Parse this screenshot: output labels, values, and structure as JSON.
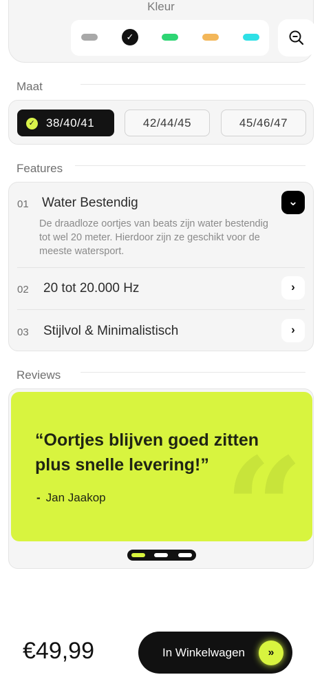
{
  "color": {
    "title": "Kleur",
    "swatches": [
      {
        "name": "grey",
        "hex": "#a8a8a8"
      },
      {
        "name": "black",
        "hex": "#111111",
        "selected": true
      },
      {
        "name": "green",
        "hex": "#2ed573"
      },
      {
        "name": "orange",
        "hex": "#f3b75a"
      },
      {
        "name": "cyan",
        "hex": "#2ee0e6"
      }
    ],
    "selected_check": "✓",
    "zoom_icon": "zoom-out-icon"
  },
  "size": {
    "heading": "Maat",
    "options": [
      "38/40/41",
      "42/44/45",
      "45/46/47"
    ],
    "selected_index": 0,
    "check": "✓"
  },
  "features": {
    "heading": "Features",
    "items": [
      {
        "num": "01",
        "title": "Water Bestendig",
        "description": "De draadloze oortjes van beats zijn water bestendig tot wel 20 meter. Hierdoor zijn ze geschikt voor de meeste watersport.",
        "expanded": true,
        "icon": "chevron-down-icon"
      },
      {
        "num": "02",
        "title": "20 tot 20.000 Hz",
        "expanded": false,
        "icon": "chevron-right-icon"
      },
      {
        "num": "03",
        "title": "Stijlvol & Minimalistisch",
        "expanded": false,
        "icon": "chevron-right-icon"
      }
    ]
  },
  "reviews": {
    "heading": "Reviews",
    "quote": "“Oortjes blijven goed zitten plus snelle levering!”",
    "author": "Jan Jaakop",
    "author_dash": "-",
    "quote_mark": "“",
    "active_slide": 0,
    "slide_count": 3
  },
  "cart": {
    "price": "€49,99",
    "button_label": "In Winkelwagen",
    "button_icon": "double-chevron-right-icon",
    "accent": "#d8f43f"
  }
}
